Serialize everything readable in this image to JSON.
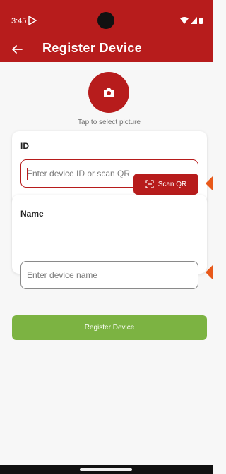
{
  "status_bar": {
    "time": "3:45"
  },
  "app_bar": {
    "title": "Register Device"
  },
  "photo": {
    "hint": "Tap to select picture"
  },
  "id_card": {
    "label": "ID",
    "placeholder": "Enter device ID or scan QR",
    "scan_label": "Scan QR"
  },
  "name_card": {
    "label": "Name",
    "placeholder": "Enter device name"
  },
  "register": {
    "label": "Register Device"
  },
  "colors": {
    "primary": "#b71c1c",
    "success": "#7cb342",
    "marker": "#e8591a"
  }
}
